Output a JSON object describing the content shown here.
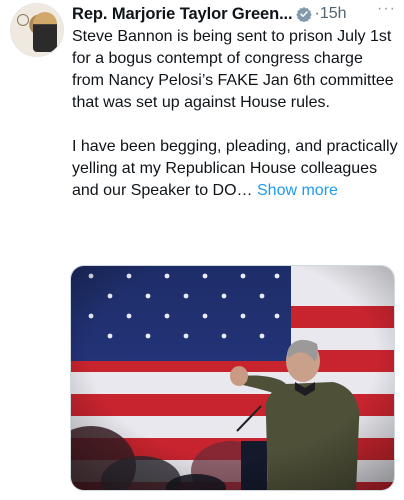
{
  "author": {
    "name": "Rep. Marjorie Taylor Green...",
    "time": "15h",
    "verified": true
  },
  "tweet": {
    "paragraph1": "Steve Bannon is being sent to prison July 1st for a bogus contempt of congress charge from Nancy Pelosi’s FAKE Jan 6th committee that was set up against House rules.",
    "paragraph2": "I have been begging, pleading, and practically yelling at my Republican House colleagues and our Speaker to DO…",
    "show_more": "Show more"
  },
  "icons": {
    "more": "more-options-icon",
    "verified": "verified-badge-icon"
  },
  "colors": {
    "link": "#1d9bf0",
    "text": "#0f1419",
    "muted": "#536471",
    "verified_badge": "#829aab"
  }
}
